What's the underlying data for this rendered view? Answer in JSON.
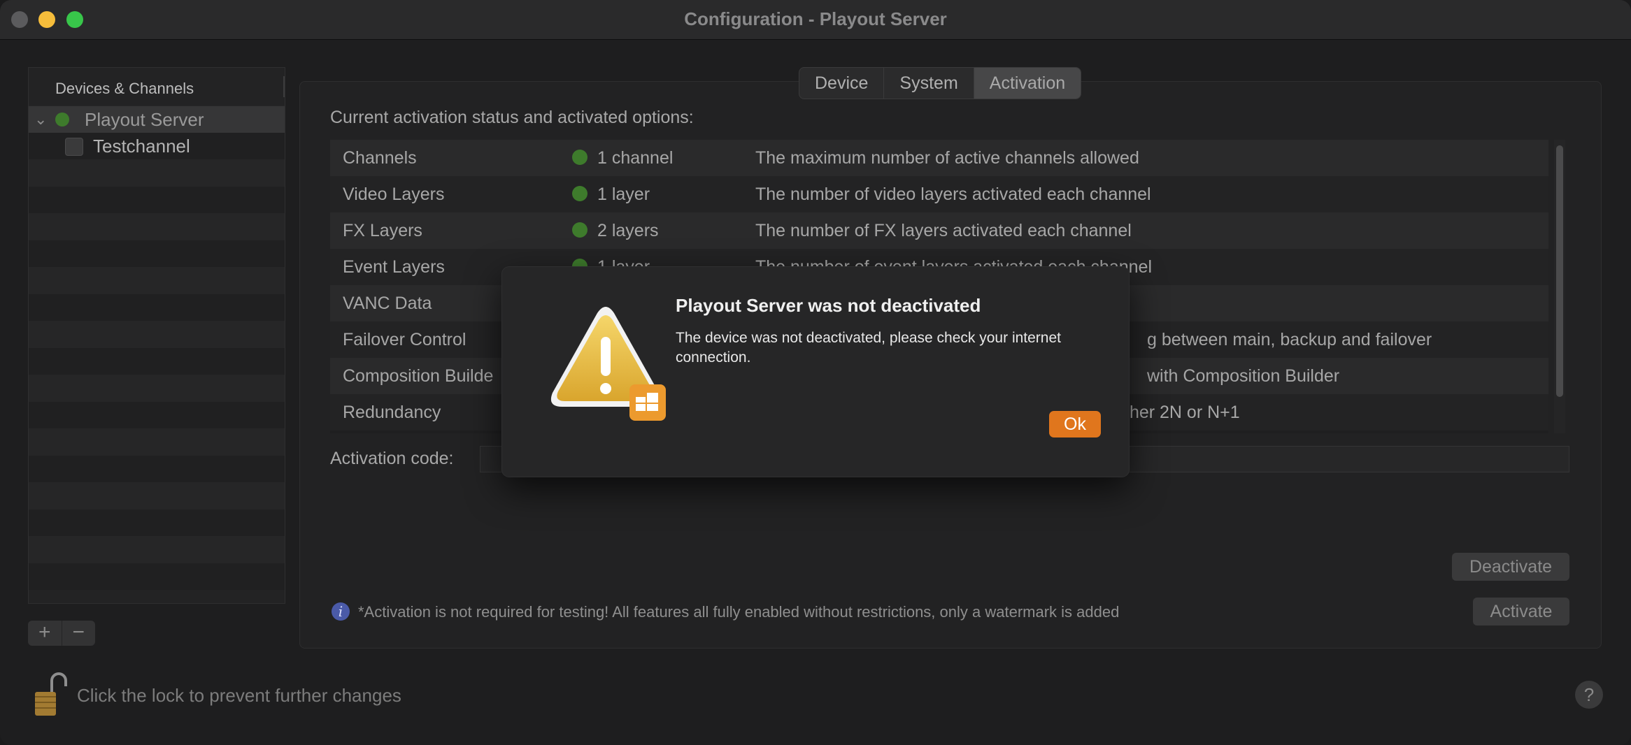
{
  "window": {
    "title": "Configuration - Playout Server"
  },
  "sidebar": {
    "header": "Devices & Channels",
    "items": [
      {
        "label": "Playout Server",
        "status_color": "#3e7b2c"
      },
      {
        "label": "Testchannel"
      }
    ]
  },
  "tabs": [
    {
      "label": "Device"
    },
    {
      "label": "System"
    },
    {
      "label": "Activation"
    }
  ],
  "activation": {
    "status_label": "Current activation status and activated options:",
    "rows": [
      {
        "name": "Channels",
        "value": "1 channel",
        "description": "The maximum number of active channels allowed"
      },
      {
        "name": "Video Layers",
        "value": "1 layer",
        "description": "The number of video layers activated each channel"
      },
      {
        "name": "FX Layers",
        "value": "2 layers",
        "description": "The number of FX layers activated each channel"
      },
      {
        "name": "Event Layers",
        "value": "1 layer",
        "description": "The number of event layers activated each channel"
      },
      {
        "name": "VANC Data",
        "value": "",
        "description": ""
      },
      {
        "name": "Failover Control",
        "value": "",
        "description": "g between main, backup and failover"
      },
      {
        "name": "Composition Builde",
        "value": "",
        "description": "with Composition Builder"
      },
      {
        "name": "Redundancy",
        "value": "",
        "description": "ther 2N or N+1"
      }
    ],
    "code_label": "Activation code:",
    "deactivate_label": "Deactivate",
    "activate_label": "Activate",
    "info_text": "*Activation is not required for testing! All features all fully enabled without restrictions, only a watermark is added"
  },
  "footer": {
    "lock_text": "Click the lock to prevent further changes",
    "help_label": "?"
  },
  "sidebar_controls": {
    "add": "+",
    "remove": "−"
  },
  "dialog": {
    "title": "Playout Server was not deactivated",
    "message": "The device was not deactivated, please check your internet connection.",
    "ok_label": "Ok"
  },
  "colors": {
    "accent": "#e0761d",
    "status_green": "#3e7b2c"
  }
}
